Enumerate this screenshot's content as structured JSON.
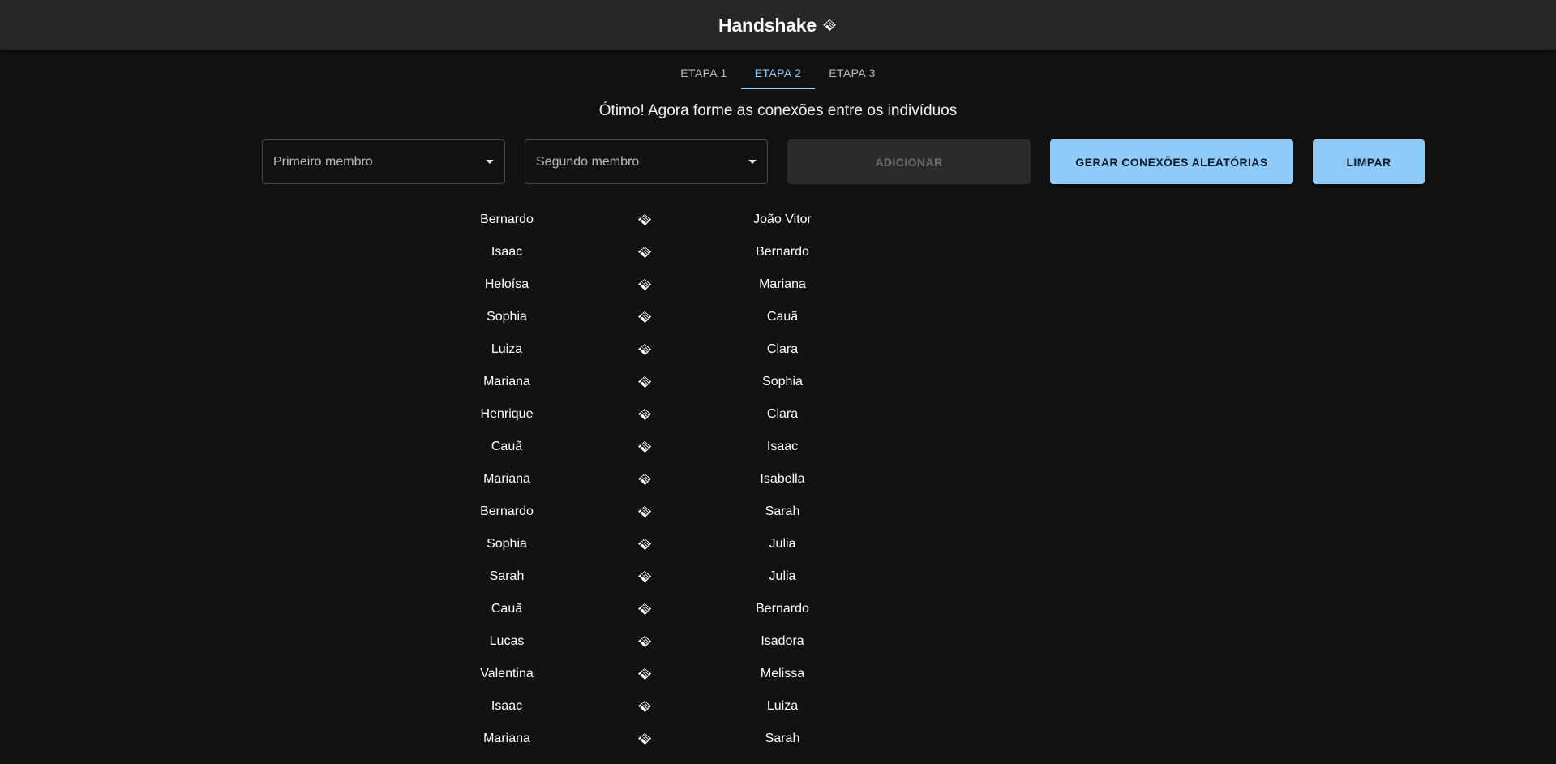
{
  "app": {
    "title": "Handshake",
    "icon": "handshake-icon"
  },
  "tabs": [
    {
      "label": "ETAPA 1",
      "active": false
    },
    {
      "label": "ETAPA 2",
      "active": true
    },
    {
      "label": "ETAPA 3",
      "active": false
    }
  ],
  "instruction": "Ótimo! Agora forme as conexões entre os indivíduos",
  "form": {
    "first_member": {
      "placeholder": "Primeiro membro",
      "value": ""
    },
    "second_member": {
      "placeholder": "Segundo membro",
      "value": ""
    },
    "add_label": "ADICIONAR",
    "random_label": "GERAR CONEXÕES ALEATÓRIAS",
    "clear_label": "LIMPAR"
  },
  "colors": {
    "background": "#121212",
    "appbar": "#272727",
    "accent": "#90caf9"
  },
  "connections": [
    {
      "a": "Bernardo",
      "b": "João Vitor"
    },
    {
      "a": "Isaac",
      "b": "Bernardo"
    },
    {
      "a": "Heloísa",
      "b": "Mariana"
    },
    {
      "a": "Sophia",
      "b": "Cauã"
    },
    {
      "a": "Luiza",
      "b": "Clara"
    },
    {
      "a": "Mariana",
      "b": "Sophia"
    },
    {
      "a": "Henrique",
      "b": "Clara"
    },
    {
      "a": "Cauã",
      "b": "Isaac"
    },
    {
      "a": "Mariana",
      "b": "Isabella"
    },
    {
      "a": "Bernardo",
      "b": "Sarah"
    },
    {
      "a": "Sophia",
      "b": "Julia"
    },
    {
      "a": "Sarah",
      "b": "Julia"
    },
    {
      "a": "Cauã",
      "b": "Bernardo"
    },
    {
      "a": "Lucas",
      "b": "Isadora"
    },
    {
      "a": "Valentina",
      "b": "Melissa"
    },
    {
      "a": "Isaac",
      "b": "Luiza"
    },
    {
      "a": "Mariana",
      "b": "Sarah"
    }
  ]
}
